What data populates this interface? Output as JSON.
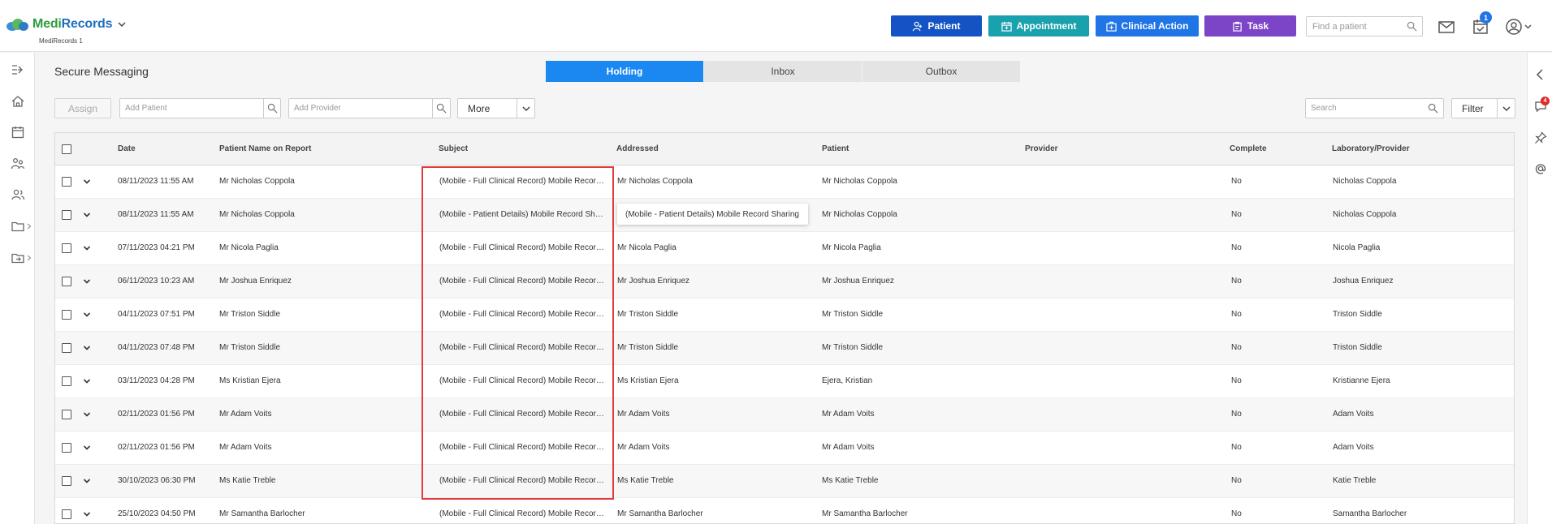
{
  "app": {
    "logo_medi": "Medi",
    "logo_records": "Records",
    "tenant": "MediRecords 1"
  },
  "header": {
    "buttons": {
      "patient": "Patient",
      "appointment": "Appointment",
      "clinical_action": "Clinical Action",
      "task": "Task"
    },
    "find_patient_placeholder": "Find a patient",
    "tasks_badge": "1",
    "colors": {
      "patient": "#1453c4",
      "appointment": "#19a1ad",
      "clinical_action": "#1f74e6",
      "task": "#7c44c7"
    }
  },
  "right_rail": {
    "chat_badge": "4"
  },
  "page": {
    "title": "Secure Messaging",
    "tabs": [
      {
        "label": "Holding",
        "active": true
      },
      {
        "label": "Inbox",
        "active": false
      },
      {
        "label": "Outbox",
        "active": false
      }
    ]
  },
  "toolbar": {
    "assign_label": "Assign",
    "add_patient_placeholder": "Add Patient",
    "add_provider_placeholder": "Add Provider",
    "more_label": "More",
    "search_placeholder": "Search",
    "filter_label": "Filter"
  },
  "table": {
    "columns": [
      "Date",
      "Patient Name on Report",
      "Subject",
      "Addressed",
      "Patient",
      "Provider",
      "Complete",
      "Laboratory/Provider"
    ],
    "rows": [
      {
        "date": "08/11/2023 11:55 AM",
        "name_on_report": "Mr Nicholas Coppola",
        "subject": "(Mobile - Full Clinical Record) Mobile Record Sharing",
        "addressed": "Mr Nicholas Coppola",
        "patient": "Mr Nicholas Coppola",
        "provider": "",
        "complete": "No",
        "lab": "Nicholas Coppola"
      },
      {
        "date": "08/11/2023 11:55 AM",
        "name_on_report": "Mr Nicholas Coppola",
        "subject": "(Mobile - Patient Details) Mobile Record Sharing",
        "addressed": "",
        "patient": "Mr Nicholas Coppola",
        "provider": "",
        "complete": "No",
        "lab": "Nicholas Coppola"
      },
      {
        "date": "07/11/2023 04:21 PM",
        "name_on_report": "Mr Nicola Paglia",
        "subject": "(Mobile - Full Clinical Record) Mobile Record Sharing",
        "addressed": "Mr Nicola Paglia",
        "patient": "Mr Nicola Paglia",
        "provider": "",
        "complete": "No",
        "lab": "Nicola Paglia"
      },
      {
        "date": "06/11/2023 10:23 AM",
        "name_on_report": "Mr Joshua Enriquez",
        "subject": "(Mobile - Full Clinical Record) Mobile Record Sharing",
        "addressed": "Mr Joshua Enriquez",
        "patient": "Mr Joshua Enriquez",
        "provider": "",
        "complete": "No",
        "lab": "Joshua Enriquez"
      },
      {
        "date": "04/11/2023 07:51 PM",
        "name_on_report": "Mr Triston Siddle",
        "subject": "(Mobile - Full Clinical Record) Mobile Record Sharing",
        "addressed": "Mr Triston Siddle",
        "patient": "Mr Triston Siddle",
        "provider": "",
        "complete": "No",
        "lab": "Triston Siddle"
      },
      {
        "date": "04/11/2023 07:48 PM",
        "name_on_report": "Mr Triston Siddle",
        "subject": "(Mobile - Full Clinical Record) Mobile Record Sharing",
        "addressed": "Mr Triston Siddle",
        "patient": "Mr Triston Siddle",
        "provider": "",
        "complete": "No",
        "lab": "Triston Siddle"
      },
      {
        "date": "03/11/2023 04:28 PM",
        "name_on_report": "Ms Kristian Ejera",
        "subject": "(Mobile - Full Clinical Record) Mobile Record Sharing",
        "addressed": "Ms Kristian Ejera",
        "patient": "Ejera, Kristian",
        "provider": "",
        "complete": "No",
        "lab": "Kristianne Ejera"
      },
      {
        "date": "02/11/2023 01:56 PM",
        "name_on_report": "Mr Adam Voits",
        "subject": "(Mobile - Full Clinical Record) Mobile Record Sharing",
        "addressed": "Mr Adam Voits",
        "patient": "Mr Adam Voits",
        "provider": "",
        "complete": "No",
        "lab": "Adam Voits"
      },
      {
        "date": "02/11/2023 01:56 PM",
        "name_on_report": "Mr Adam Voits",
        "subject": "(Mobile - Full Clinical Record) Mobile Record Sharing",
        "addressed": "Mr Adam Voits",
        "patient": "Mr Adam Voits",
        "provider": "",
        "complete": "No",
        "lab": "Adam Voits"
      },
      {
        "date": "30/10/2023 06:30 PM",
        "name_on_report": "Ms Katie Treble",
        "subject": "(Mobile - Full Clinical Record) Mobile Record Sharing",
        "addressed": "Ms Katie Treble",
        "patient": "Ms Katie Treble",
        "provider": "",
        "complete": "No",
        "lab": "Katie Treble"
      },
      {
        "date": "25/10/2023 04:50 PM",
        "name_on_report": "Mr Samantha Barlocher",
        "subject": "(Mobile - Full Clinical Record) Mobile Record Sharing",
        "addressed": "Mr Samantha Barlocher",
        "patient": "Mr Samantha Barlocher",
        "provider": "",
        "complete": "No",
        "lab": "Samantha Barlocher"
      }
    ]
  },
  "tooltip": {
    "text": "(Mobile - Patient Details) Mobile Record Sharing"
  }
}
